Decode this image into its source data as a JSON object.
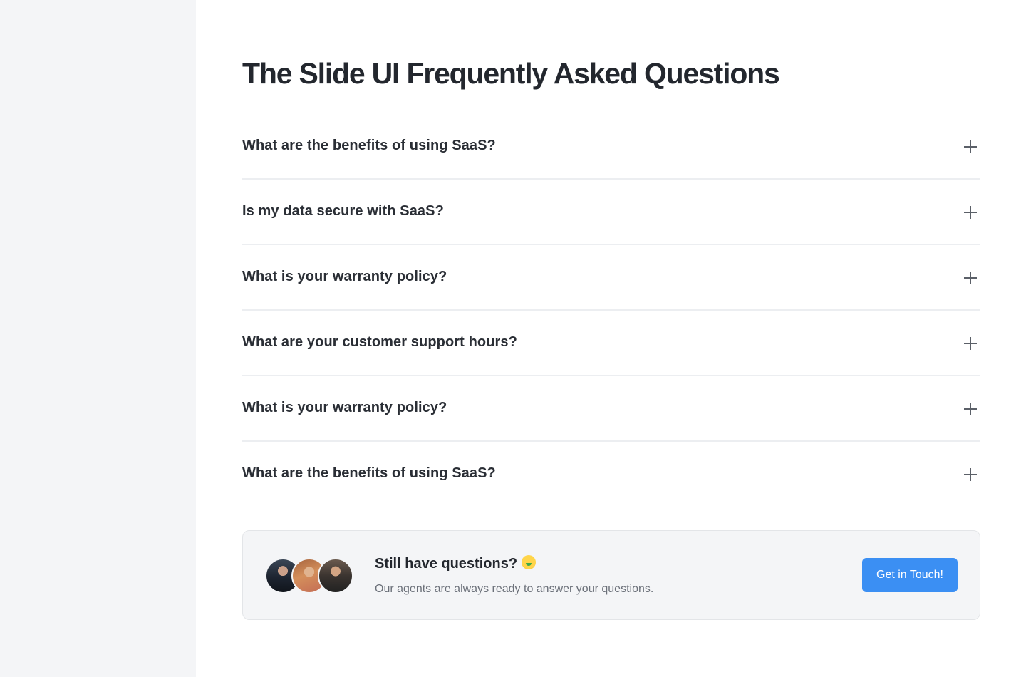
{
  "page": {
    "title": "The Slide UI Frequently Asked Questions"
  },
  "faq": {
    "items": [
      {
        "question": "What are the benefits of using SaaS?"
      },
      {
        "question": "Is my data secure with SaaS?"
      },
      {
        "question": "What is your warranty policy?"
      },
      {
        "question": "What are your customer support hours?"
      },
      {
        "question": "What is your warranty policy?"
      },
      {
        "question": "What are the benefits of using SaaS?"
      }
    ],
    "toggle_icon": "plus-icon"
  },
  "cta": {
    "title": "Still have questions?",
    "emoji_icon": "money-mouth-face-emoji",
    "subtitle": "Our agents are always ready to answer your questions.",
    "button_label": "Get in Touch!",
    "avatars": [
      "avatar-1",
      "avatar-2",
      "avatar-3"
    ]
  },
  "colors": {
    "accent": "#3b8ff3",
    "sidebar_bg": "#f4f5f7",
    "divider": "#eceef1"
  }
}
